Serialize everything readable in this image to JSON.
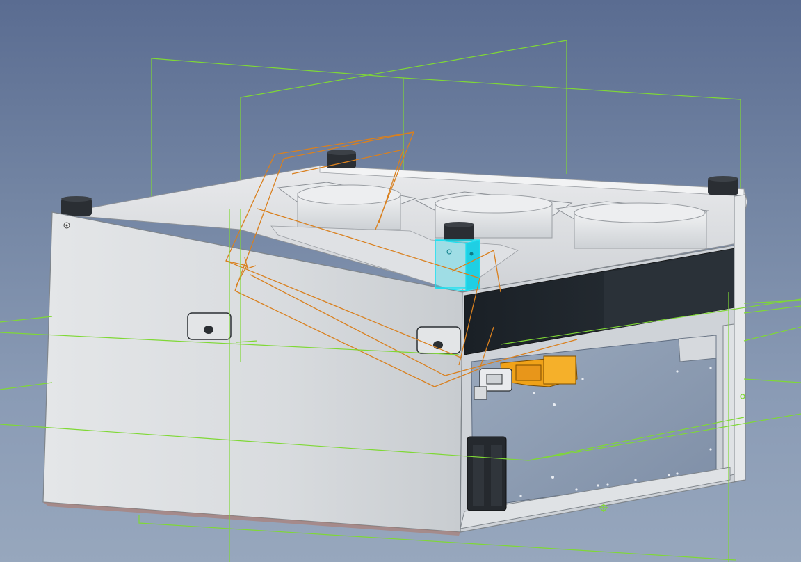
{
  "viewport": {
    "background_top": "#5a6c91",
    "background_bottom": "#97a7bd"
  },
  "colors": {
    "work_plane": "#7fd835",
    "sketch": "#d9801f",
    "selection": "#1fe0f0",
    "highlight_part": "#f0a218",
    "body_light": "#dcdee0",
    "body_shade": "#b9bdc2",
    "dark_band": "#1f252b",
    "interior_panel": "#8496ad"
  },
  "model": {
    "name": "enclosure-assembly-3d-view",
    "parts": [
      "chassis-body",
      "top-fan-1",
      "top-fan-2",
      "top-fan-3",
      "feet",
      "side-handle-left",
      "side-handle-right",
      "connector-block",
      "battery-block",
      "selected-bracket"
    ]
  }
}
